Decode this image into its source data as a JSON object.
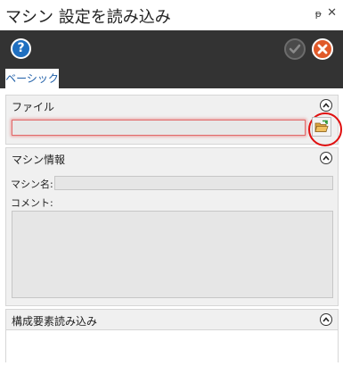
{
  "window": {
    "title": "マシン 設定を読み込み",
    "pin_glyph": "ᵽ",
    "close_glyph": "✕"
  },
  "toolbar": {
    "help_label": "?"
  },
  "tabs": [
    {
      "label": "ベーシック",
      "selected": true
    }
  ],
  "sections": {
    "file": {
      "title": "ファイル",
      "path_value": ""
    },
    "machine_info": {
      "title": "マシン情報",
      "name_label": "マシン名:",
      "name_value": "",
      "comment_label": "コメント:",
      "comment_value": ""
    },
    "import_components": {
      "title": "構成要素読み込み"
    }
  },
  "colors": {
    "toolbar_bg": "#333333",
    "accent_blue": "#1f6fc0",
    "cancel_orange": "#e05a2a",
    "error_red": "#e26a6a",
    "highlight_red": "#e01010"
  }
}
